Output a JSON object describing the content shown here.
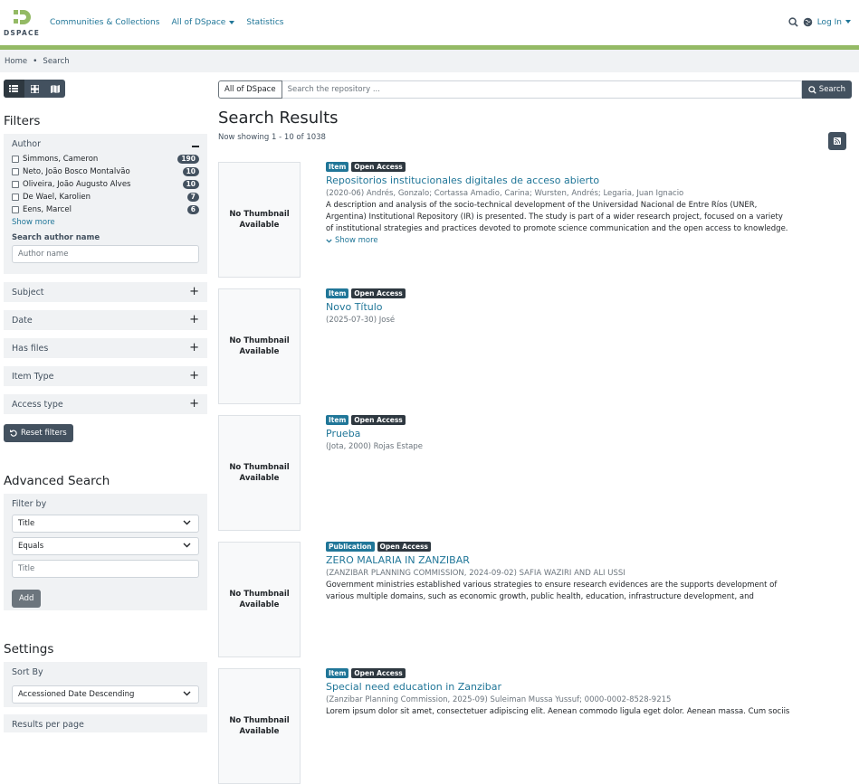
{
  "header": {
    "logo_text": "DSPACE",
    "nav": [
      "Communities & Collections",
      "All of DSpace",
      "Statistics"
    ],
    "login_label": "Log In",
    "colors": {
      "accent": "#94ba65",
      "link": "#207698",
      "dark": "#43515f"
    }
  },
  "breadcrumb": {
    "home": "Home",
    "current": "Search"
  },
  "filters": {
    "title": "Filters",
    "author": {
      "title": "Author",
      "options": [
        {
          "label": "Simmons, Cameron",
          "count": "190"
        },
        {
          "label": "Neto, João Bosco Montalvão",
          "count": "10"
        },
        {
          "label": "Oliveira, João Augusto Alves",
          "count": "10"
        },
        {
          "label": "De Wael, Karolien",
          "count": "7"
        },
        {
          "label": "Eens, Marcel",
          "count": "6"
        }
      ],
      "show_more": "Show more",
      "search_label": "Search author name",
      "search_placeholder": "Author name"
    },
    "facets": [
      "Subject",
      "Date",
      "Has files",
      "Item Type",
      "Access type"
    ],
    "reset_label": "Reset filters"
  },
  "advanced": {
    "title": "Advanced Search",
    "filter_by": "Filter by",
    "field_value": "Title",
    "operator_value": "Equals",
    "value_placeholder": "Title",
    "add_label": "Add"
  },
  "settings": {
    "title": "Settings",
    "sort_label": "Sort By",
    "sort_value": "Accessioned Date Descending",
    "rpp_label": "Results per page"
  },
  "search": {
    "scope": "All of DSpace",
    "placeholder": "Search the repository ...",
    "button": "Search"
  },
  "results": {
    "title": "Search Results",
    "showing": "Now showing 1 - 10 of 1038",
    "no_thumb": "No Thumbnail Available",
    "items": [
      {
        "type": "Item",
        "access": "Open Access",
        "title": "Repositorios institucionales digitales de acceso abierto",
        "meta": "(2020-06) Andrés, Gonzalo; Cortassa Amadio, Carina; Wursten, Andrés; Legaria, Juan Ignacio",
        "abstract": "A description and analysis of the socio-technical development of the Universidad Nacional de Entre Ríos (UNER, Argentina) Institutional Repository (IR) is presented. The study is part of a wider research project, focused on a variety of institutional strategies and practices devoted to promote science communication and the open access to knowledge. Relying on the Social Studies of...",
        "more": "Show more"
      },
      {
        "type": "Item",
        "access": "Open Access",
        "title": "Novo Título",
        "meta": "(2025-07-30) José"
      },
      {
        "type": "Item",
        "access": "Open Access",
        "title": "Prueba",
        "meta": "(Jota, 2000) Rojas Estape"
      },
      {
        "type": "Publication",
        "access": "Open Access",
        "title": "ZERO MALARIA IN ZANZIBAR",
        "meta": "(ZANZIBAR PLANNING COMMISSION, 2024-09-02) SAFIA WAZIRI AND ALI USSI",
        "abstract": "Government ministries established various strategies to ensure research evidences are the supports development of various multiple domains, such as economic growth, public health, education, infrastructure development, and environmental"
      },
      {
        "type": "Item",
        "access": "Open Access",
        "title": "Special need education in Zanzibar",
        "meta": "(Zanzibar Planning Commission, 2025-09) Suleiman Mussa Yussuf; 0000-0002-8528-9215",
        "abstract": "Lorem ipsum dolor sit amet, consectetuer adipiscing elit. Aenean commodo ligula eget dolor. Aenean massa. Cum sociis natoque pe-"
      }
    ]
  }
}
